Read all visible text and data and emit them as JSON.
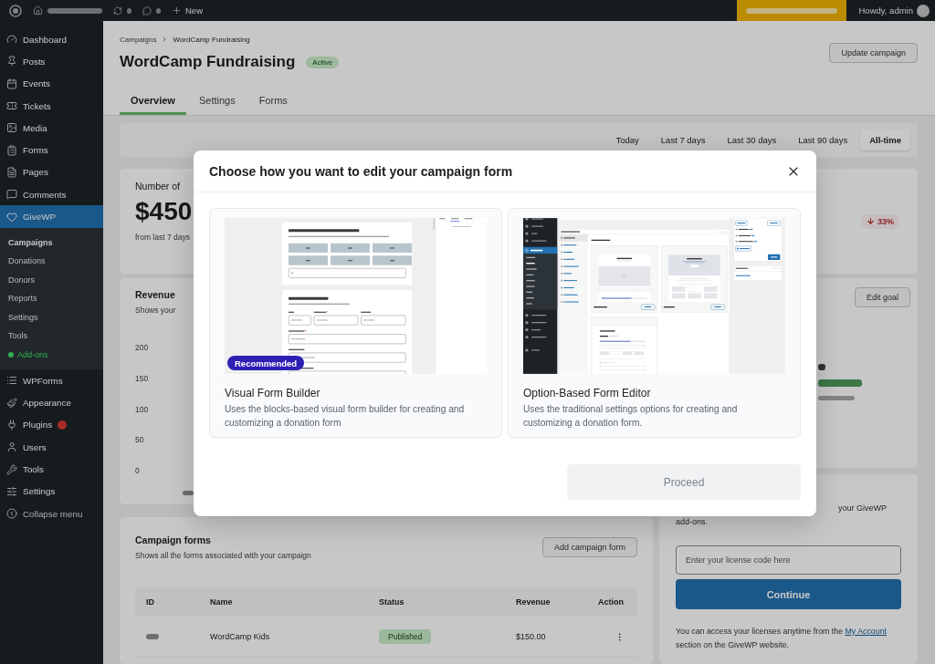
{
  "admin_bar": {
    "new_label": "New",
    "greeting": "Howdy, admin"
  },
  "sidebar": {
    "items": [
      {
        "label": "Dashboard",
        "kind": "menu",
        "selected": false,
        "update_badge": false
      },
      {
        "label": "Posts",
        "kind": "menu",
        "selected": false,
        "update_badge": false
      },
      {
        "label": "Events",
        "kind": "menu",
        "selected": false,
        "update_badge": false
      },
      {
        "label": "Tickets",
        "kind": "menu",
        "selected": false,
        "update_badge": false
      },
      {
        "label": "Media",
        "kind": "menu",
        "selected": false,
        "update_badge": false
      },
      {
        "label": "Forms",
        "kind": "menu",
        "selected": false,
        "update_badge": false
      },
      {
        "label": "Pages",
        "kind": "menu",
        "selected": false,
        "update_badge": false
      },
      {
        "label": "Comments",
        "kind": "menu",
        "selected": false,
        "update_badge": false
      },
      {
        "label": "GiveWP",
        "kind": "menu",
        "selected": true,
        "update_badge": false,
        "children": [
          {
            "label": "Campaigns",
            "kind": "link",
            "selected": true
          },
          {
            "label": "Donations",
            "kind": "link",
            "selected": false
          },
          {
            "label": "Donors",
            "kind": "link",
            "selected": false
          },
          {
            "label": "Reports",
            "kind": "link",
            "selected": false
          },
          {
            "label": "Settings",
            "kind": "link",
            "selected": false
          },
          {
            "label": "Tools",
            "kind": "link",
            "selected": false
          },
          {
            "label": "Add-ons",
            "kind": "addon",
            "selected": false
          }
        ]
      },
      {
        "label": "WPForms",
        "kind": "menu",
        "selected": false,
        "update_badge": false
      },
      {
        "label": "Appearance",
        "kind": "menu",
        "selected": false,
        "update_badge": false
      },
      {
        "label": "Plugins",
        "kind": "menu",
        "selected": false,
        "update_badge": true
      },
      {
        "label": "Users",
        "kind": "menu",
        "selected": false,
        "update_badge": false
      },
      {
        "label": "Tools",
        "kind": "menu",
        "selected": false,
        "update_badge": false
      },
      {
        "label": "Settings",
        "kind": "menu",
        "selected": false,
        "update_badge": false
      },
      {
        "label": "Collapse menu",
        "kind": "collapse",
        "selected": false,
        "update_badge": false
      }
    ]
  },
  "page": {
    "breadcrumb": [
      "Campaigns",
      "WordCamp Fundraising"
    ],
    "title": "WordCamp Fundraising",
    "status": "Active",
    "update_button": "Update campaign",
    "tabs": [
      {
        "label": "Overview",
        "selected": true
      },
      {
        "label": "Settings",
        "selected": false
      },
      {
        "label": "Forms",
        "selected": false
      }
    ],
    "date_filters": [
      {
        "label": "Today",
        "selected": false
      },
      {
        "label": "Last 7 days",
        "selected": false
      },
      {
        "label": "Last 30 days",
        "selected": false
      },
      {
        "label": "Last 90 days",
        "selected": false
      },
      {
        "label": "All-time",
        "selected": true
      }
    ],
    "stat": {
      "label": "Number of",
      "value": "$450",
      "caption": "from last 7 days"
    },
    "change_badge": "33%",
    "revenue": {
      "title": "Revenue",
      "subtitle": "Shows your",
      "axis_labels": [
        "200",
        "150",
        "100",
        "50",
        "0"
      ]
    },
    "goal": {
      "button": "Edit goal"
    },
    "license": {
      "text_lines": [
        "your GiveWP",
        "add-ons."
      ],
      "placeholder": "Enter your license code here",
      "button": "Continue",
      "note_before": "You can access your licenses anytime from the",
      "note_link": "My Account",
      "note_after": "section on the GiveWP website."
    },
    "campaign_forms": {
      "title": "Campaign forms",
      "subtitle": "Shows all the forms associated with your campaign",
      "add_button": "Add campaign form",
      "columns": [
        "ID",
        "Name",
        "Status",
        "Revenue",
        "Action"
      ],
      "rows": [
        {
          "name": "WordCamp Kids",
          "status": "Published",
          "revenue": "$150.00"
        }
      ]
    }
  },
  "modal": {
    "title": "Choose how you want to edit your campaign form",
    "options": [
      {
        "kind": "visual",
        "title": "Visual Form Builder",
        "description": "Uses the blocks-based visual form builder for creating and customizing a donation form",
        "badge": "Recommended",
        "selected": false
      },
      {
        "kind": "classic",
        "title": "Option-Based Form Editor",
        "description": "Uses the traditional settings options for creating and customizing a donation form.",
        "selected": false
      }
    ],
    "proceed": {
      "label": "Proceed",
      "disabled": true
    }
  }
}
